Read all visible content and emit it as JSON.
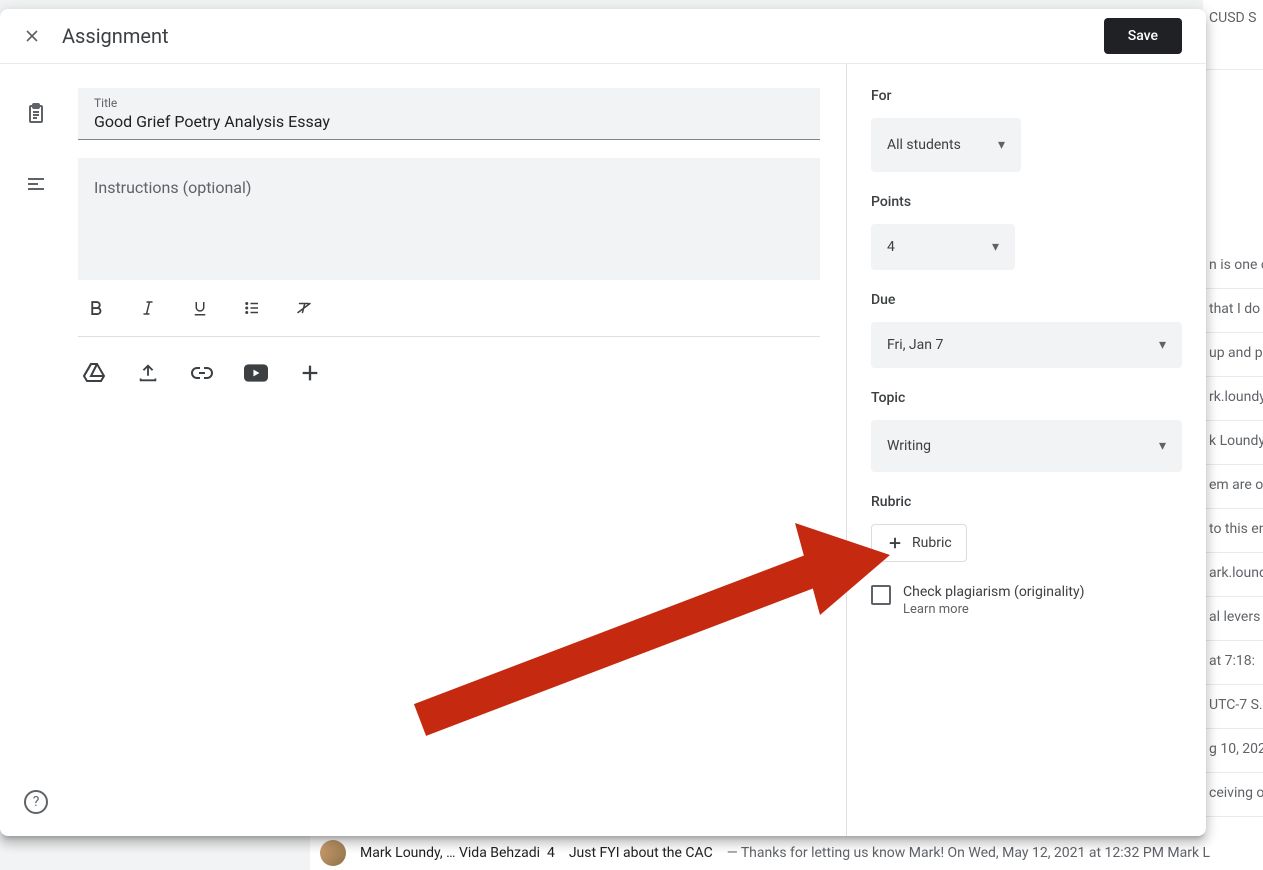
{
  "dialog": {
    "header_title": "Assignment",
    "save_label": "Save",
    "title_label": "Title",
    "title_value": "Good Grief Poetry Analysis Essay",
    "instructions_placeholder": "Instructions (optional)"
  },
  "sidebar": {
    "for_label": "For",
    "for_value": "All students",
    "points_label": "Points",
    "points_value": "4",
    "due_label": "Due",
    "due_value": "Fri, Jan 7",
    "topic_label": "Topic",
    "topic_value": "Writing",
    "rubric_label": "Rubric",
    "rubric_btn": "Rubric",
    "plagiarism_label": "Check plagiarism (originality)",
    "plagiarism_learn": "Learn more"
  },
  "background": {
    "header_text": "CUSD S",
    "rows": [
      "n is one o",
      " that I do",
      "up and po",
      "rk.loundy",
      "k Loundy",
      "em are o",
      "to this en",
      "ark.lound",
      "al levers",
      " at 7:18:",
      "UTC-7 S.",
      "g 10, 202",
      "ceiving o"
    ],
    "email": {
      "sender": "Mark Loundy, … Vida Behzadi",
      "count": "4",
      "subject": "Just FYI about the CAC",
      "preview": "Thanks for letting us know Mark! On Wed, May 12, 2021 at 12:32 PM Mark L"
    }
  }
}
